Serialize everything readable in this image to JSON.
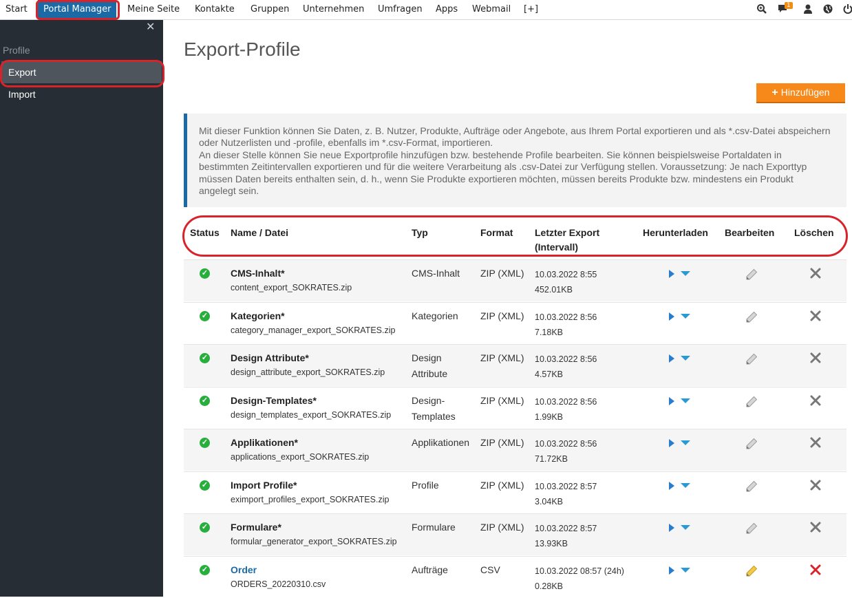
{
  "topnav": {
    "items": [
      "Start",
      "Portal Manager",
      "Meine Seite",
      "Kontakte",
      "Gruppen",
      "Unternehmen",
      "Umfragen",
      "Apps",
      "Webmail",
      "[+]"
    ],
    "notification_count": "1"
  },
  "sidebar": {
    "heading": "Profile",
    "items": [
      "Export",
      "Import"
    ],
    "active": "Export"
  },
  "main": {
    "title": "Export-Profile",
    "add_button": "Hinzufügen",
    "info_lines": [
      "Mit dieser Funktion können Sie Daten, z. B. Nutzer, Produkte, Aufträge oder Angebote, aus Ihrem Portal exportieren und als *.csv-Datei abspeichern oder Nutzerlisten und -profile, ebenfalls im *.csv-Format, importieren.",
      "An dieser Stelle können Sie neue Exportprofile hinzufügen bzw. bestehende Profile bearbeiten. Sie können beispielsweise Portaldaten in bestimmten Zeitintervallen exportieren und für die weitere Verarbeitung als .csv-Datei zur Verfügung stellen. Voraussetzung: Je nach Exporttyp müssen Daten bereits enthalten sein, d. h., wenn Sie Produkte exportieren möchten, müssen bereits Produkte bzw. mindestens ein Produkt angelegt sein."
    ],
    "table": {
      "headers": {
        "status": "Status",
        "name": "Name / Datei",
        "typ": "Typ",
        "format": "Format",
        "export_line1": "Letzter Export",
        "export_line2": "(Intervall)",
        "download": "Herunterladen",
        "edit": "Bearbeiten",
        "delete": "Löschen"
      },
      "rows": [
        {
          "name": "CMS-Inhalt*",
          "file": "content_export_SOKRATES.zip",
          "typ": "CMS-Inhalt",
          "format": "ZIP (XML)",
          "date": "10.03.2022 8:55",
          "size": "452.01KB",
          "editable": false
        },
        {
          "name": "Kategorien*",
          "file": "category_manager_export_SOKRATES.zip",
          "typ": "Kategorien",
          "format": "ZIP (XML)",
          "date": "10.03.2022 8:56",
          "size": "7.18KB",
          "editable": false
        },
        {
          "name": "Design Attribute*",
          "file": "design_attribute_export_SOKRATES.zip",
          "typ": "Design Attribute",
          "format": "ZIP (XML)",
          "date": "10.03.2022 8:56",
          "size": "4.57KB",
          "editable": false
        },
        {
          "name": "Design-Templates*",
          "file": "design_templates_export_SOKRATES.zip",
          "typ": "Design-Templates",
          "format": "ZIP (XML)",
          "date": "10.03.2022 8:56",
          "size": "1.99KB",
          "editable": false
        },
        {
          "name": "Applikationen*",
          "file": "applications_export_SOKRATES.zip",
          "typ": "Applikationen",
          "format": "ZIP (XML)",
          "date": "10.03.2022 8:56",
          "size": "71.72KB",
          "editable": false
        },
        {
          "name": "Import Profile*",
          "file": "eximport_profiles_export_SOKRATES.zip",
          "typ": "Profile",
          "format": "ZIP (XML)",
          "date": "10.03.2022 8:57",
          "size": "3.04KB",
          "editable": false
        },
        {
          "name": "Formulare*",
          "file": "formular_generator_export_SOKRATES.zip",
          "typ": "Formulare",
          "format": "ZIP (XML)",
          "date": "10.03.2022 8:57",
          "size": "13.93KB",
          "editable": false
        },
        {
          "name": "Order",
          "file": "ORDERS_20220310.csv",
          "typ": "Aufträge",
          "format": "CSV",
          "date": "10.03.2022 08:57 (24h)",
          "size": "0.28KB",
          "editable": true
        }
      ]
    }
  },
  "colors": {
    "accent": "#1b6aa5",
    "button": "#f7891a",
    "highlight": "#d9232a",
    "status_ok": "#27ae3c"
  }
}
